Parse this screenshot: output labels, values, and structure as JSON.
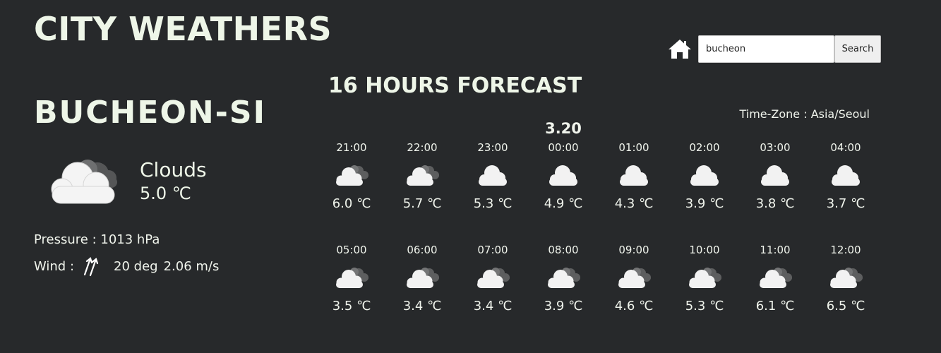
{
  "app": {
    "title": "CITY WEATHERS"
  },
  "search": {
    "value": "bucheon",
    "button_label": "Search"
  },
  "current": {
    "city": "BUCHEON-SI",
    "condition": "Clouds",
    "temperature": "5.0 ℃",
    "icon": "broken-clouds-icon",
    "pressure": "Pressure : 1013 hPa",
    "wind_label": "Wind :",
    "wind_deg": "20 deg",
    "wind_speed": "2.06 m/s"
  },
  "forecast": {
    "title": "16 HOURS FORECAST",
    "timezone": "Time-Zone : Asia/Seoul",
    "date_label": "3.20",
    "hours": [
      {
        "time": "21:00",
        "temp": "6.0 ℃",
        "icon": "broken-clouds-icon"
      },
      {
        "time": "22:00",
        "temp": "5.7 ℃",
        "icon": "broken-clouds-icon"
      },
      {
        "time": "23:00",
        "temp": "5.3 ℃",
        "icon": "cloud-icon"
      },
      {
        "time": "00:00",
        "temp": "4.9 ℃",
        "icon": "cloud-icon"
      },
      {
        "time": "01:00",
        "temp": "4.3 ℃",
        "icon": "cloud-icon"
      },
      {
        "time": "02:00",
        "temp": "3.9 ℃",
        "icon": "cloud-icon"
      },
      {
        "time": "03:00",
        "temp": "3.8 ℃",
        "icon": "cloud-icon"
      },
      {
        "time": "04:00",
        "temp": "3.7 ℃",
        "icon": "cloud-icon"
      },
      {
        "time": "05:00",
        "temp": "3.5 ℃",
        "icon": "broken-clouds-icon"
      },
      {
        "time": "06:00",
        "temp": "3.4 ℃",
        "icon": "broken-clouds-icon"
      },
      {
        "time": "07:00",
        "temp": "3.4 ℃",
        "icon": "broken-clouds-icon"
      },
      {
        "time": "08:00",
        "temp": "3.9 ℃",
        "icon": "broken-clouds-icon"
      },
      {
        "time": "09:00",
        "temp": "4.6 ℃",
        "icon": "broken-clouds-icon"
      },
      {
        "time": "10:00",
        "temp": "5.3 ℃",
        "icon": "broken-clouds-icon"
      },
      {
        "time": "11:00",
        "temp": "6.1 ℃",
        "icon": "broken-clouds-icon"
      },
      {
        "time": "12:00",
        "temp": "6.5 ℃",
        "icon": "broken-clouds-icon"
      }
    ]
  }
}
